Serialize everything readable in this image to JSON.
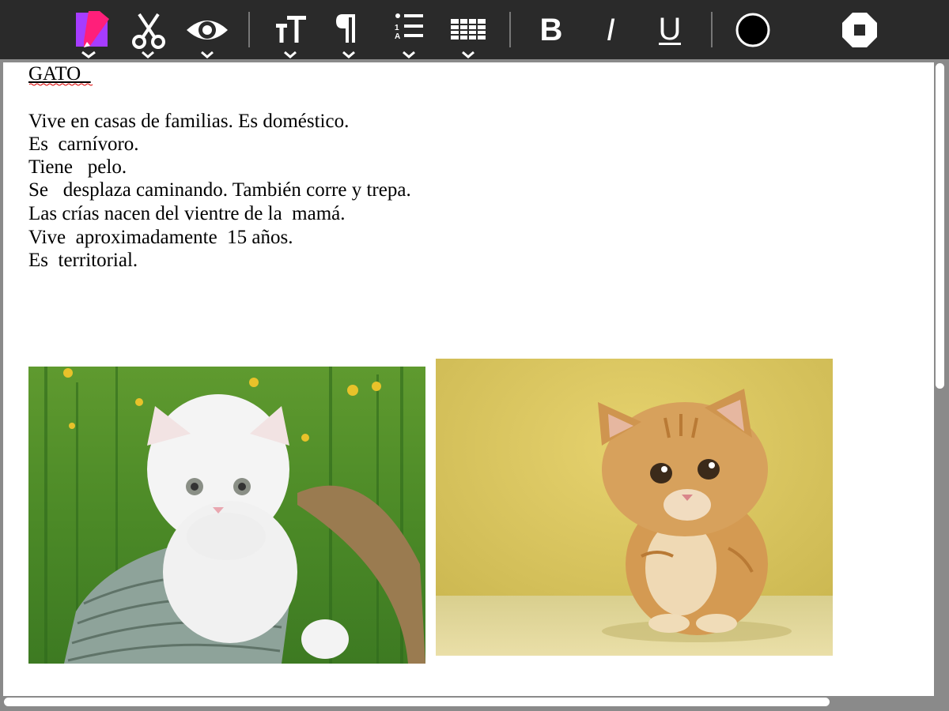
{
  "toolbar": {
    "buttons": [
      {
        "name": "new-document",
        "icon": "document-pencil-icon",
        "has_dropdown": true
      },
      {
        "name": "cut",
        "icon": "scissors-icon",
        "has_dropdown": true
      },
      {
        "name": "view",
        "icon": "eye-icon",
        "has_dropdown": true
      },
      {
        "name": "text-size",
        "icon": "text-size-icon",
        "has_dropdown": true
      },
      {
        "name": "paragraph",
        "icon": "pilcrow-icon",
        "has_dropdown": true
      },
      {
        "name": "list",
        "icon": "numbered-list-icon",
        "has_dropdown": true
      },
      {
        "name": "table",
        "icon": "table-icon",
        "has_dropdown": true
      },
      {
        "name": "bold",
        "icon": "bold-icon",
        "label": "B"
      },
      {
        "name": "italic",
        "icon": "italic-icon",
        "label": "I"
      },
      {
        "name": "underline",
        "icon": "underline-icon",
        "label": "U"
      },
      {
        "name": "text-color",
        "icon": "color-circle-icon",
        "color": "#000000"
      },
      {
        "name": "stop",
        "icon": "stop-octagon-icon"
      }
    ],
    "background": "#2a2a2a",
    "accent_colors": {
      "doc_icon_magenta": "#ff1f7a",
      "doc_icon_purple": "#a63cff"
    }
  },
  "document": {
    "title": "GATO  ",
    "lines": [
      "Vive en casas de familias. Es doméstico.",
      "Es  carnívoro.",
      "Tiene   pelo.",
      "Se   desplaza caminando. También corre y trepa.",
      "Las crías nacen del vientre de la  mamá.",
      "Vive  aproximadamente  15 años.",
      "Es  territorial."
    ],
    "images": [
      {
        "name": "white-kitten-in-basket",
        "description_icon": "photo-icon"
      },
      {
        "name": "orange-kitten-sitting",
        "description_icon": "photo-icon"
      }
    ]
  }
}
